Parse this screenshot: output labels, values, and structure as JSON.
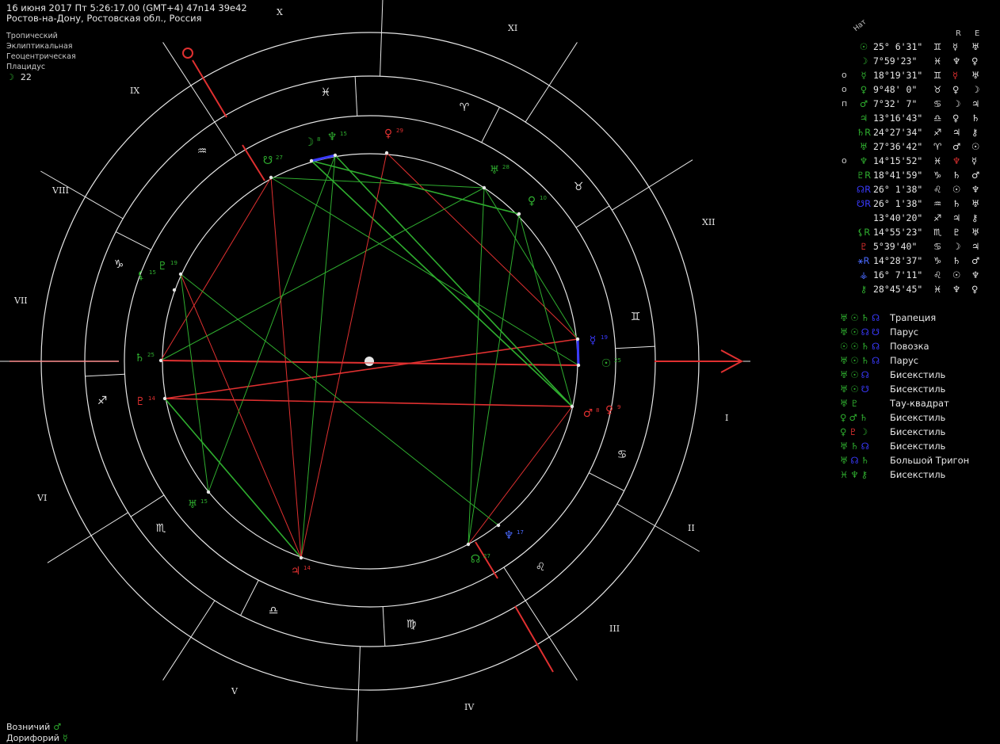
{
  "header": {
    "line1": "16 июня 2017  Пт   5:26:17.00 (GMT+4) 47n14  39e42",
    "line2": "Ростов-на-Дону, Ростовская обл., Россия"
  },
  "settings": [
    "Тропический",
    "Эклиптикальная",
    "Геоцентрическая",
    "Плацидус"
  ],
  "moon_day": {
    "glyph": "☽",
    "value": "22"
  },
  "chart_labels": {
    "houses": [
      "I",
      "II",
      "III",
      "IV",
      "V",
      "VI",
      "VII",
      "VIII",
      "IX",
      "X",
      "XI",
      "XII"
    ],
    "signs": [
      "♈",
      "♉",
      "♊",
      "♋",
      "♌",
      "♍",
      "♎",
      "♏",
      "♐",
      "♑",
      "♒",
      "♓"
    ]
  },
  "planets_on_chart": [
    {
      "glyph": "☉",
      "deg": "25",
      "color": "#2fae2f"
    },
    {
      "glyph": "☿",
      "deg": "19",
      "color": "#3a3aff"
    },
    {
      "glyph": "♂",
      "deg": "8",
      "color": "#e03030"
    },
    {
      "glyph": "♀",
      "deg": "9",
      "color": "#e03030"
    },
    {
      "glyph": "♆",
      "deg": "17",
      "color": "#4a6aff"
    },
    {
      "glyph": "☊",
      "deg": "27",
      "color": "#2fae2f"
    },
    {
      "glyph": "♃",
      "deg": "14",
      "color": "#e03030"
    },
    {
      "glyph": "⚸",
      "deg": "15",
      "color": "#2fae2f"
    },
    {
      "glyph": "♇",
      "deg": "14",
      "color": "#e03030"
    },
    {
      "glyph": "♄",
      "deg": "25",
      "color": "#2fae2f"
    },
    {
      "glyph": "♅",
      "deg": "15",
      "color": "#2fae2f"
    },
    {
      "glyph": "♇",
      "deg": "19",
      "color": "#2fae2f"
    },
    {
      "glyph": "☋",
      "deg": "27",
      "color": "#2fae2f"
    },
    {
      "glyph": "☽",
      "deg": "8",
      "color": "#2fae2f"
    },
    {
      "glyph": "♆",
      "deg": "15",
      "color": "#2fae2f"
    },
    {
      "glyph": "♀",
      "deg": "29",
      "color": "#e03030"
    },
    {
      "glyph": "♅",
      "deg": "28",
      "color": "#2fae2f"
    },
    {
      "glyph": "♀",
      "deg": "10",
      "color": "#2fae2f"
    }
  ],
  "table": {
    "nat_label": "Нат",
    "r_label": "R",
    "e_label": "E",
    "rows": [
      {
        "mk": "",
        "gl": "☉",
        "glc": "#2fae2f",
        "pos": "25° 6'31\"",
        "sg": "♊",
        "rl": "☿",
        "rlc": "#e6e6e6",
        "el": "♅",
        "elc": "#e6e6e6"
      },
      {
        "mk": "",
        "gl": "☽",
        "glc": "#2fae2f",
        "pos": " 7°59'23\"",
        "sg": "♓",
        "rl": "♆",
        "rlc": "#e6e6e6",
        "el": "♀",
        "elc": "#e6e6e6"
      },
      {
        "mk": "o",
        "gl": "☿",
        "glc": "#2fae2f",
        "pos": "18°19'31\"",
        "sg": "♊",
        "rl": "☿",
        "rlc": "#e03030",
        "el": "♅",
        "elc": "#e6e6e6"
      },
      {
        "mk": "o",
        "gl": "♀",
        "glc": "#2fae2f",
        "pos": " 9°48' 0\"",
        "sg": "♉",
        "rl": "♀",
        "rlc": "#e6e6e6",
        "el": "☽",
        "elc": "#e6e6e6"
      },
      {
        "mk": "п",
        "gl": "♂",
        "glc": "#2fae2f",
        "pos": " 7°32' 7\"",
        "sg": "♋",
        "rl": "☽",
        "rlc": "#e6e6e6",
        "el": "♃",
        "elc": "#e6e6e6"
      },
      {
        "mk": "",
        "gl": "♃",
        "glc": "#2fae2f",
        "pos": "13°16'43\"",
        "sg": "♎",
        "rl": "♀",
        "rlc": "#e6e6e6",
        "el": "♄",
        "elc": "#e6e6e6"
      },
      {
        "mk": "",
        "gl": "♄R",
        "glc": "#2fae2f",
        "pos": "24°27'34\"",
        "sg": "♐",
        "rl": "♃",
        "rlc": "#e6e6e6",
        "el": "⚷",
        "elc": "#e6e6e6"
      },
      {
        "mk": "",
        "gl": "♅",
        "glc": "#2fae2f",
        "pos": "27°36'42\"",
        "sg": "♈",
        "rl": "♂",
        "rlc": "#e6e6e6",
        "el": "☉",
        "elc": "#e6e6e6"
      },
      {
        "mk": "o",
        "gl": "♆",
        "glc": "#2fae2f",
        "pos": "14°15'52\"",
        "sg": "♓",
        "rl": "♆",
        "rlc": "#e03030",
        "el": "☿",
        "elc": "#e6e6e6"
      },
      {
        "mk": "",
        "gl": "♇R",
        "glc": "#2fae2f",
        "pos": "18°41'59\"",
        "sg": "♑",
        "rl": "♄",
        "rlc": "#e6e6e6",
        "el": "♂",
        "elc": "#e6e6e6"
      },
      {
        "mk": "",
        "gl": "☊R",
        "glc": "#3a3aff",
        "pos": "26° 1'38\"",
        "sg": "♌",
        "rl": "☉",
        "rlc": "#e6e6e6",
        "el": "♆",
        "elc": "#e6e6e6"
      },
      {
        "mk": "",
        "gl": "☋R",
        "glc": "#3a3aff",
        "pos": "26° 1'38\"",
        "sg": "♒",
        "rl": "♄",
        "rlc": "#e6e6e6",
        "el": "♅",
        "elc": "#e6e6e6"
      },
      {
        "mk": "",
        "gl": "",
        "glc": "#2fae2f",
        "pos": "13°40'20\"",
        "sg": "♐",
        "rl": "♃",
        "rlc": "#e6e6e6",
        "el": "⚷",
        "elc": "#e6e6e6"
      },
      {
        "mk": "",
        "gl": "⚸R",
        "glc": "#2fae2f",
        "pos": "14°55'23\"",
        "sg": "♏",
        "rl": "♇",
        "rlc": "#e6e6e6",
        "el": "♅",
        "elc": "#e6e6e6"
      },
      {
        "mk": "",
        "gl": "♇",
        "glc": "#e03030",
        "pos": " 5°39'40\"",
        "sg": "♋",
        "rl": "☽",
        "rlc": "#e6e6e6",
        "el": "♃",
        "elc": "#e6e6e6"
      },
      {
        "mk": "",
        "gl": "⚹R",
        "glc": "#4a6aff",
        "pos": "14°28'37\"",
        "sg": "♑",
        "rl": "♄",
        "rlc": "#e6e6e6",
        "el": "♂",
        "elc": "#e6e6e6"
      },
      {
        "mk": "",
        "gl": "⚶",
        "glc": "#4a6aff",
        "pos": "16° 7'11\"",
        "sg": "♌",
        "rl": "☉",
        "rlc": "#e6e6e6",
        "el": "♆",
        "elc": "#e6e6e6"
      },
      {
        "mk": "",
        "gl": "⚷",
        "glc": "#2fae2f",
        "pos": "28°45'45\"",
        "sg": "♓",
        "rl": "♆",
        "rlc": "#e6e6e6",
        "el": "♀",
        "elc": "#e6e6e6"
      }
    ]
  },
  "aspect_figures": [
    {
      "glyphs": [
        {
          "g": "♅",
          "c": "#2fae2f"
        },
        {
          "g": "☉",
          "c": "#2fae2f"
        },
        {
          "g": "♄",
          "c": "#2fae2f"
        },
        {
          "g": "☊",
          "c": "#3a3aff"
        }
      ],
      "name": "Трапеция"
    },
    {
      "glyphs": [
        {
          "g": "♅",
          "c": "#2fae2f"
        },
        {
          "g": "☉",
          "c": "#2fae2f"
        },
        {
          "g": "☊",
          "c": "#3a3aff"
        },
        {
          "g": "☋",
          "c": "#3a3aff"
        }
      ],
      "name": "Парус"
    },
    {
      "glyphs": [
        {
          "g": "☉",
          "c": "#2fae2f"
        },
        {
          "g": "☉",
          "c": "#2fae2f"
        },
        {
          "g": "♄",
          "c": "#2fae2f"
        },
        {
          "g": "☊",
          "c": "#3a3aff"
        }
      ],
      "name": "Повозка"
    },
    {
      "glyphs": [
        {
          "g": "♅",
          "c": "#2fae2f"
        },
        {
          "g": "☉",
          "c": "#2fae2f"
        },
        {
          "g": "♄",
          "c": "#2fae2f"
        },
        {
          "g": "☊",
          "c": "#3a3aff"
        }
      ],
      "name": "Парус"
    },
    {
      "glyphs": [
        {
          "g": "♅",
          "c": "#2fae2f"
        },
        {
          "g": "☉",
          "c": "#2fae2f"
        },
        {
          "g": "☊",
          "c": "#3a3aff"
        }
      ],
      "name": "Бисекстиль"
    },
    {
      "glyphs": [
        {
          "g": "♅",
          "c": "#2fae2f"
        },
        {
          "g": "☉",
          "c": "#2fae2f"
        },
        {
          "g": "☋",
          "c": "#3a3aff"
        }
      ],
      "name": "Бисекстиль"
    },
    {
      "glyphs": [
        {
          "g": "♅",
          "c": "#2fae2f"
        },
        {
          "g": "♇",
          "c": "#2fae2f"
        }
      ],
      "name": "Тау-квадрат"
    },
    {
      "glyphs": [
        {
          "g": "♀",
          "c": "#2fae2f"
        },
        {
          "g": "♂",
          "c": "#2fae2f"
        },
        {
          "g": "♄",
          "c": "#2fae2f"
        }
      ],
      "name": "Бисекстиль"
    },
    {
      "glyphs": [
        {
          "g": "♀",
          "c": "#2fae2f"
        },
        {
          "g": "♇",
          "c": "#e03030"
        },
        {
          "g": "☽",
          "c": "#2fae2f"
        }
      ],
      "name": "Бисекстиль"
    },
    {
      "glyphs": [
        {
          "g": "♅",
          "c": "#2fae2f"
        },
        {
          "g": "♄",
          "c": "#2fae2f"
        },
        {
          "g": "☊",
          "c": "#3a3aff"
        }
      ],
      "name": "Бисекстиль"
    },
    {
      "glyphs": [
        {
          "g": "♅",
          "c": "#2fae2f"
        },
        {
          "g": "☊",
          "c": "#3a3aff"
        },
        {
          "g": "♄",
          "c": "#2fae2f"
        }
      ],
      "name": "Большой Тригон"
    },
    {
      "glyphs": [
        {
          "g": "♓",
          "c": "#2fae2f"
        },
        {
          "g": "♆",
          "c": "#2fae2f"
        },
        {
          "g": "⚷",
          "c": "#2fae2f"
        }
      ],
      "name": "Бисекстиль"
    }
  ],
  "footer": [
    {
      "label": "Возничий",
      "glyph": "♂"
    },
    {
      "label": "Дорифорий",
      "glyph": "☿"
    }
  ],
  "colors": {
    "green": "#2fae2f",
    "red": "#e03030",
    "blue": "#3a3aff",
    "white": "#e6e6e6"
  }
}
